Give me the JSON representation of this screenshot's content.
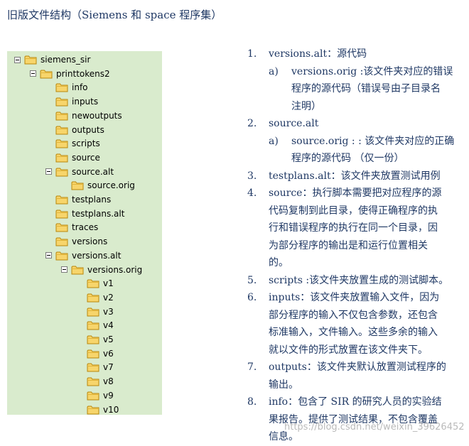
{
  "heading": "旧版文件结构（Siemens 和 space 程序集）",
  "tree": {
    "background": "#d9ebcd",
    "nodes": [
      {
        "label": "siemens_sir",
        "expanded": true
      },
      {
        "label": "printtokens2",
        "expanded": true
      },
      {
        "label": "info"
      },
      {
        "label": "inputs"
      },
      {
        "label": "newoutputs"
      },
      {
        "label": "outputs"
      },
      {
        "label": "scripts"
      },
      {
        "label": "source"
      },
      {
        "label": "source.alt",
        "expanded": true
      },
      {
        "label": "source.orig"
      },
      {
        "label": "testplans"
      },
      {
        "label": "testplans.alt"
      },
      {
        "label": "traces"
      },
      {
        "label": "versions"
      },
      {
        "label": "versions.alt",
        "expanded": true
      },
      {
        "label": "versions.orig",
        "expanded": true
      },
      {
        "label": "v1"
      },
      {
        "label": "v2"
      },
      {
        "label": "v3"
      },
      {
        "label": "v4"
      },
      {
        "label": "v5"
      },
      {
        "label": "v6"
      },
      {
        "label": "v7"
      },
      {
        "label": "v8"
      },
      {
        "label": "v9"
      },
      {
        "label": "v10"
      }
    ]
  },
  "list": {
    "items": [
      {
        "num": "1.",
        "lines": [
          "versions.alt：源代码"
        ]
      },
      {
        "num": "a)",
        "sub": true,
        "lines": [
          "versions.orig :该文件夹对应的错误",
          "程序的源代码（错误号由子目录名",
          "注明）"
        ]
      },
      {
        "num": "2.",
        "lines": [
          "source.alt"
        ]
      },
      {
        "num": "a)",
        "sub": true,
        "lines": [
          "source.orig : : 该文件夹对应的正确",
          "程序的源代码 （仅一份）"
        ]
      },
      {
        "num": "3.",
        "lines": [
          "testplans.alt：该文件夹放置测试用例"
        ]
      },
      {
        "num": "4.",
        "lines": [
          "source：执行脚本需要把对应程序的源",
          "代码复制到此目录，使得正确程序的执",
          "行和错误程序的执行在同一个目录，因",
          "为部分程序的输出是和运行位置相关",
          "的。"
        ]
      },
      {
        "num": "5.",
        "lines": [
          "scripts :该文件夹放置生成的测试脚本。"
        ]
      },
      {
        "num": "6.",
        "lines": [
          "inputs：该文件夹放置输入文件，因为",
          "部分程序的输入不仅包含参数，还包含",
          "标准输入，文件输入。这些多余的输入",
          "就以文件的形式放置在该文件夹下。"
        ]
      },
      {
        "num": "7.",
        "lines": [
          "outputs：该文件夹默认放置测试程序的",
          "输出。"
        ]
      },
      {
        "num": "8.",
        "lines": [
          "info：包含了 SIR 的研究人员的实验结",
          "果报告。提供了测试结果，不包含覆盖",
          "信息。"
        ]
      }
    ]
  },
  "watermark": "https://blog.csdn.net/weixin_39626452"
}
